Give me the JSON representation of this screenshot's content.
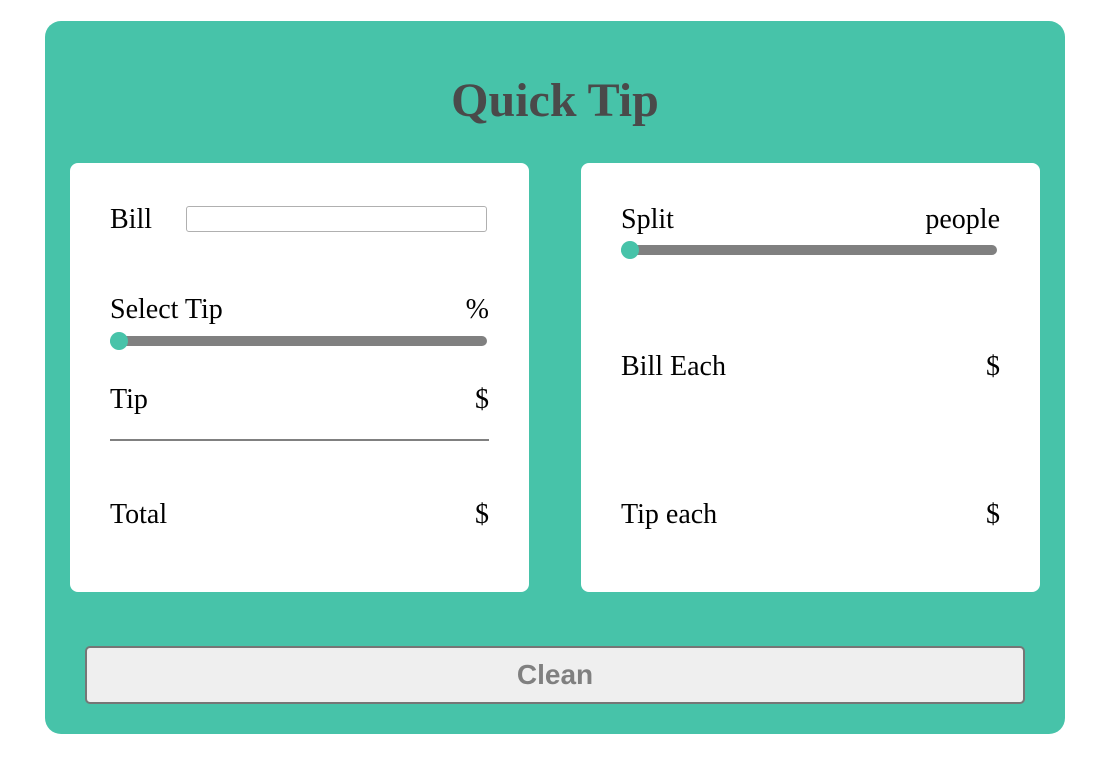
{
  "app": {
    "title": "Quick Tip"
  },
  "calculator": {
    "bill_label": "Bill",
    "bill_value": "",
    "bill_placeholder": "",
    "select_tip_label": "Select Tip",
    "tip_percent_value": "%",
    "tip_slider_fraction": 0,
    "tip_label": "Tip",
    "tip_value": "$",
    "total_label": "Total",
    "total_value": "$"
  },
  "split": {
    "split_label": "Split",
    "people_value": "people",
    "split_slider_fraction": 0,
    "bill_each_label": "Bill Each",
    "bill_each_value": "$",
    "tip_each_label": "Tip each",
    "tip_each_value": "$"
  },
  "actions": {
    "clean_label": "Clean"
  },
  "colors": {
    "accent": "#47c3a9",
    "title_text": "#4a4a4a",
    "slider_track": "#808080",
    "button_text": "#808080"
  }
}
